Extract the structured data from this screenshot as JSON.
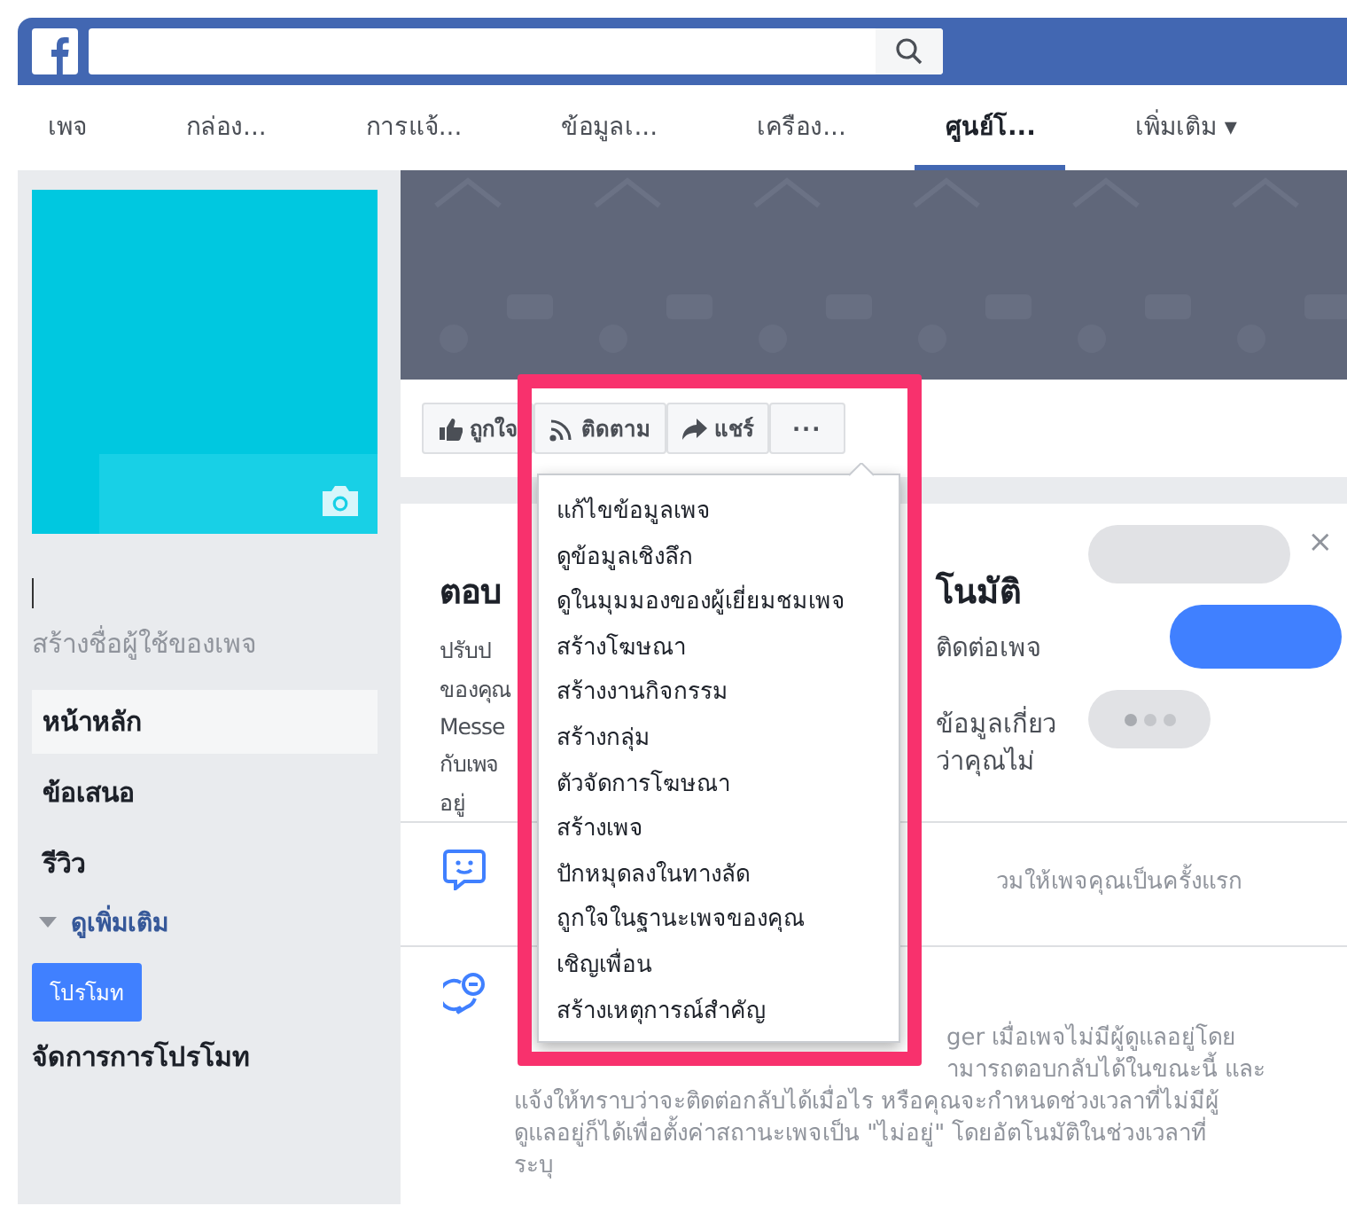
{
  "nav_tabs": [
    {
      "label": "เพจ",
      "selected": false
    },
    {
      "label": "กล่อง...",
      "selected": false
    },
    {
      "label": "การแจ้...",
      "selected": false
    },
    {
      "label": "ข้อมูลเ...",
      "selected": false
    },
    {
      "label": "เครือง...",
      "selected": false
    },
    {
      "label": "ศูนย์โ...",
      "selected": true
    },
    {
      "label": "เพิ่มเติม ▾",
      "selected": false
    }
  ],
  "sidebar": {
    "username_link": "สร้างชื่อผู้ใช้ของเพจ",
    "items": [
      {
        "label": "หน้าหลัก",
        "selected": true
      },
      {
        "label": "ข้อเสนอ",
        "selected": false
      },
      {
        "label": "รีวิว",
        "selected": false
      }
    ],
    "see_more": "ดูเพิ่มเติม",
    "promote_button": "โปรโมท",
    "manage_promotions": "จัดการการโปรโมท"
  },
  "actions": [
    {
      "kind": "like",
      "label": "ถูกใจ"
    },
    {
      "kind": "follow",
      "label": "ติดตาม"
    },
    {
      "kind": "share",
      "label": "แชร์"
    },
    {
      "kind": "more",
      "label": "···"
    }
  ],
  "menu": {
    "items": [
      "แก้ไขข้อมูลเพจ",
      "ดูข้อมูลเชิงลึก",
      "ดูในมุมมองของผู้เยี่ยมชมเพจ",
      "สร้างโฆษณา",
      "สร้างงานกิจกรรม",
      "สร้างกลุ่ม",
      "ตัวจัดการโฆษณา",
      "สร้างเพจ",
      "ปักหมุดลงในทางลัด",
      "ถูกใจในฐานะเพจของคุณ",
      "เชิญเพื่อน",
      "สร้างเหตุการณ์สำคัญ"
    ]
  },
  "card": {
    "close": "×",
    "title_left": "ตอบ",
    "title_right": "โนมัติ",
    "lines": [
      {
        "left": "ปรับป",
        "right": "ติดต่อเพจ"
      },
      {
        "left": "ของคุณ"
      },
      {
        "left": "Messe",
        "right": "ข้อมูลเกี่ยว"
      },
      {
        "left": "กับเพจ",
        "right": "ว่าคุณไม่"
      },
      {
        "left": "อยู่"
      }
    ],
    "rows": [
      {
        "kind": "smile",
        "text_right": [
          "วมให้เพจคุณเป็นครั้งแรก"
        ]
      },
      {
        "kind": "away",
        "text_right": [
          "ger เมื่อเพจไม่มีผู้ดูแลอยู่โดย",
          "ามารถตอบกลับได้ในขณะนี้ และ"
        ],
        "text": [
          "แจ้งให้ทราบว่าจะติดต่อกลับได้เมื่อไร หรือคุณจะกำหนดช่วงเวลาที่ไม่มีผู้",
          "ดูแลอยู่ก็ได้เพื่อตั้งค่าสถานะเพจเป็น \"ไม่อยู่\" โดยอัตโนมัติในช่วงเวลาที่",
          "ระบุ"
        ]
      }
    ]
  }
}
